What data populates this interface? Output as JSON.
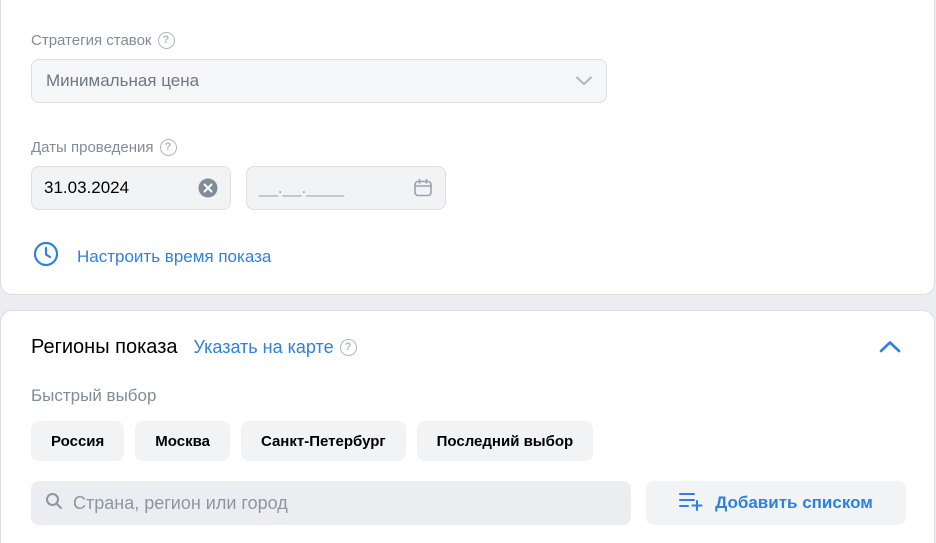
{
  "bid_strategy": {
    "label": "Стратегия ставок",
    "value": "Минимальная цена"
  },
  "dates": {
    "label": "Даты проведения",
    "start_value": "31.03.2024",
    "end_placeholder": "__.__.____"
  },
  "schedule_link": "Настроить время показа",
  "regions": {
    "title": "Регионы показа",
    "map_link": "Указать на карте",
    "quick_label": "Быстрый выбор",
    "chips": [
      "Россия",
      "Москва",
      "Санкт-Петербург",
      "Последний выбор"
    ],
    "search_placeholder": "Страна, регион или город",
    "add_list_label": "Добавить списком"
  },
  "colors": {
    "accent": "#2d81e0",
    "muted": "#818c99",
    "field_bg": "#f2f3f5"
  },
  "icons": {
    "help": "help-icon",
    "chevron": "chevron-down-icon",
    "clear": "clear-icon",
    "calendar": "calendar-icon",
    "clock": "clock-icon",
    "collapse": "chevron-up-icon",
    "search": "search-icon",
    "add_list": "list-add-icon"
  }
}
